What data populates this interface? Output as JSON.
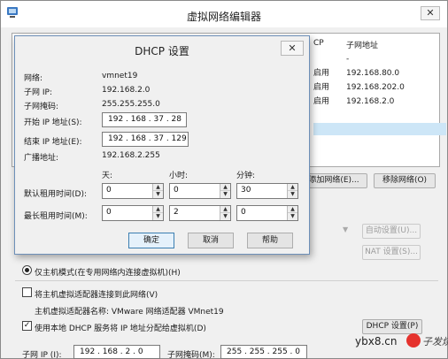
{
  "window": {
    "title": "虚拟网络编辑器",
    "close": "✕"
  },
  "table": {
    "headers": [
      "CP",
      "子网地址"
    ],
    "rows": [
      {
        "dhcp": "",
        "subnet": "-"
      },
      {
        "dhcp": "启用",
        "subnet": "192.168.80.0"
      },
      {
        "dhcp": "启用",
        "subnet": "192.168.202.0"
      },
      {
        "dhcp": "启用",
        "subnet": "192.168.2.0"
      }
    ]
  },
  "main_buttons": {
    "add_network": "添加网络(E)...",
    "remove_network": "移除网络(O)",
    "auto_settings": "自动设置(U)...",
    "nat_settings": "NAT 设置(S)..."
  },
  "options": {
    "host_only": "仅主机模式(在专用网络内连接虚拟机)(H)",
    "connect_adapter": "将主机虚拟适配器连接到此网络(V)",
    "adapter_name": "主机虚拟适配器名称: VMware 网络适配器 VMnet19",
    "use_dhcp": "使用本地 DHCP 服务将 IP 地址分配给虚拟机(D)",
    "dhcp_settings_button": "DHCP 设置(P)"
  },
  "subnet_row": {
    "ip_label": "子网 IP (I):",
    "ip_value": "192 . 168 . 2  .  0",
    "mask_label": "子网掩码(M):",
    "mask_value": "255 . 255 . 255 . 0"
  },
  "dhcp_dialog": {
    "title": "DHCP 设置",
    "close": "✕",
    "network_label": "网络:",
    "network_value": "vmnet19",
    "subnet_ip_label": "子网 IP:",
    "subnet_ip_value": "192.168.2.0",
    "subnet_mask_label": "子网掩码:",
    "subnet_mask_value": "255.255.255.0",
    "start_ip_label": "开始 IP 地址(S):",
    "start_ip_value": "192 . 168 . 37 . 28",
    "end_ip_label": "结束 IP 地址(E):",
    "end_ip_value": "192 . 168 . 37 . 129",
    "broadcast_label": "广播地址:",
    "broadcast_value": "192.168.2.255",
    "col_days": "天:",
    "col_hours": "小时:",
    "col_minutes": "分钟:",
    "default_lease_label": "默认租用时间(D):",
    "default_lease": {
      "days": "0",
      "hours": "0",
      "minutes": "30"
    },
    "max_lease_label": "最长租用时间(M):",
    "max_lease": {
      "days": "0",
      "hours": "2",
      "minutes": "0"
    },
    "ok": "确定",
    "cancel": "取消",
    "help": "帮助",
    "spin_up": "▲",
    "spin_down": "▼"
  },
  "watermark": {
    "site": "ybx8.cn",
    "brand": "电子发烧友"
  },
  "colors": {
    "selection": "#cde6f7",
    "dialog_border": "#6d8fb8",
    "logo_red": "#e5322d"
  }
}
